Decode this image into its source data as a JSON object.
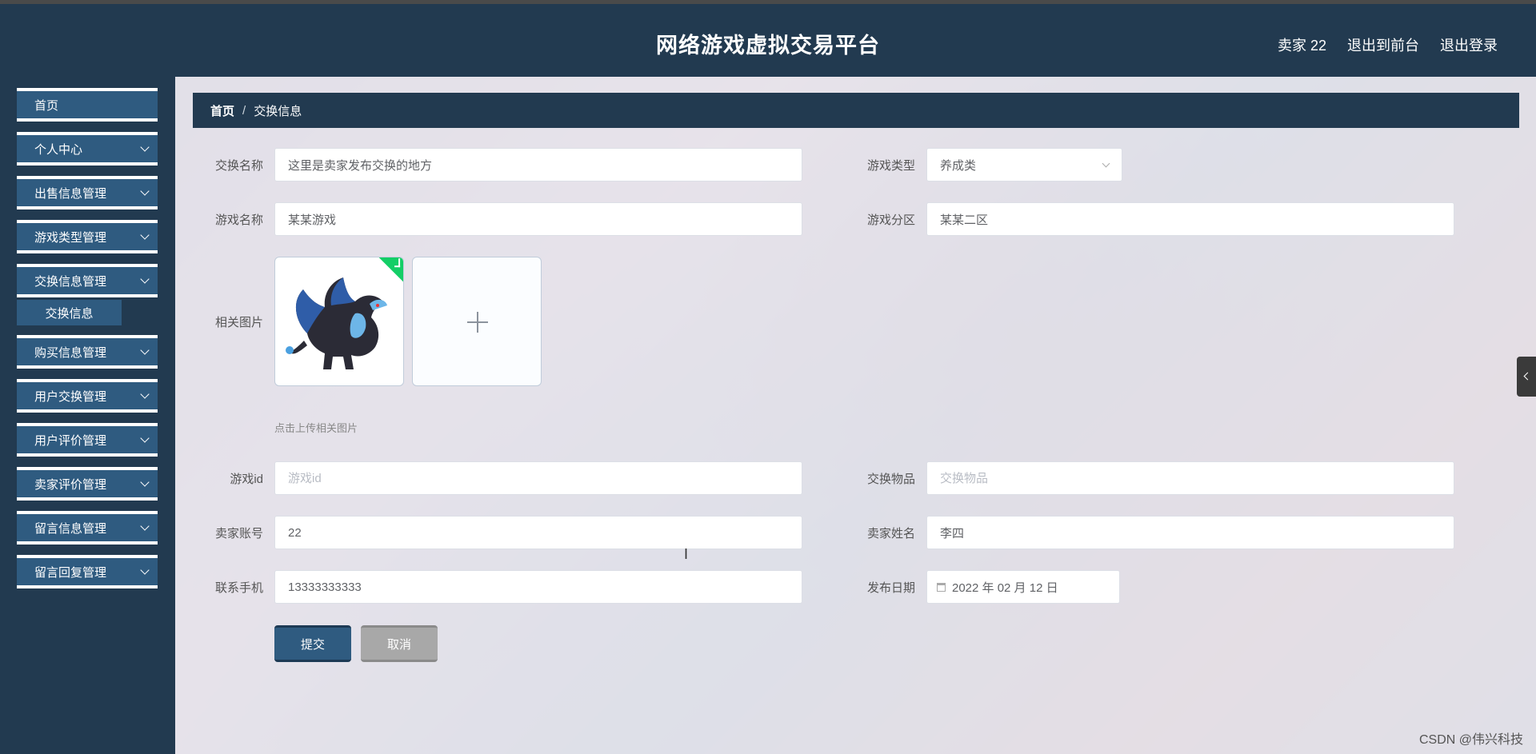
{
  "header": {
    "title": "网络游戏虚拟交易平台",
    "user_label": "卖家 22",
    "back_front_label": "退出到前台",
    "logout_label": "退出登录"
  },
  "sidebar": {
    "items": [
      {
        "label": "首页"
      },
      {
        "label": "个人中心"
      },
      {
        "label": "出售信息管理"
      },
      {
        "label": "游戏类型管理"
      },
      {
        "label": "交换信息管理"
      },
      {
        "label": "购买信息管理"
      },
      {
        "label": "用户交换管理"
      },
      {
        "label": "用户评价管理"
      },
      {
        "label": "卖家评价管理"
      },
      {
        "label": "留言信息管理"
      },
      {
        "label": "留言回复管理"
      }
    ],
    "subitem": "交换信息"
  },
  "breadcrumb": {
    "home": "首页",
    "separator": "/",
    "current": "交换信息"
  },
  "form": {
    "exchange_name": {
      "label": "交换名称",
      "value": "这里是卖家发布交换的地方"
    },
    "game_type": {
      "label": "游戏类型",
      "value": "养成类"
    },
    "game_name": {
      "label": "游戏名称",
      "value": "某某游戏"
    },
    "game_zone": {
      "label": "游戏分区",
      "value": "某某二区"
    },
    "images": {
      "label": "相关图片",
      "tip": "点击上传相关图片"
    },
    "game_id": {
      "label": "游戏id",
      "placeholder": "游戏id"
    },
    "exchange_item": {
      "label": "交换物品",
      "placeholder": "交换物品"
    },
    "seller_account": {
      "label": "卖家账号",
      "value": "22"
    },
    "seller_name": {
      "label": "卖家姓名",
      "value": "李四"
    },
    "phone": {
      "label": "联系手机",
      "value": "13333333333"
    },
    "publish_date": {
      "label": "发布日期",
      "value": "2022 年 02 月 12 日"
    },
    "submit_label": "提交",
    "cancel_label": "取消"
  },
  "watermark": "CSDN @伟兴科技",
  "colors": {
    "header_bg": "#223a50",
    "menu_bg": "#2f5b80",
    "success": "#13ce66"
  }
}
